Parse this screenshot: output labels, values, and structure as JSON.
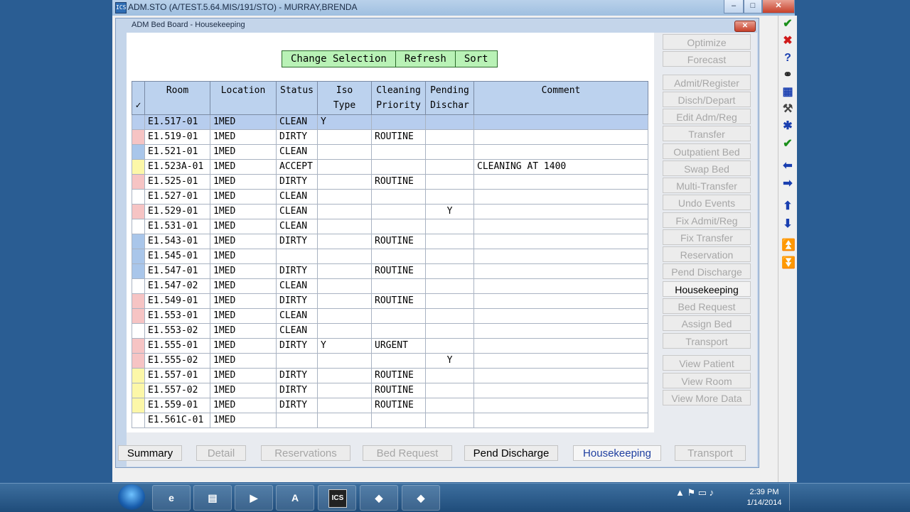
{
  "window": {
    "title": "ADM.STO (A/TEST.5.64.MIS/191/STO) - MURRAY,BRENDA",
    "app_icon": "ICS",
    "minimize": "–",
    "maximize": "□",
    "close": "✕"
  },
  "dialog": {
    "title": "ADM Bed Board - Housekeeping",
    "close": "✕"
  },
  "top_buttons": [
    "Change Selection",
    "Refresh",
    "Sort"
  ],
  "table": {
    "headers": {
      "check": "✓",
      "room": "Room",
      "location": "Location",
      "status": "Status",
      "iso1": "Iso",
      "iso2": "Type",
      "clean1": "Cleaning",
      "clean2": "Priority",
      "pend1": "Pending",
      "pend2": "Dischar",
      "comment": "Comment"
    },
    "rows": [
      {
        "color": "none",
        "room": "E1.517-01",
        "location": "1MED",
        "status": "CLEAN",
        "iso": "Y",
        "priority": "",
        "pending": "",
        "comment": ""
      },
      {
        "color": "pink",
        "room": "E1.519-01",
        "location": "1MED",
        "status": "DIRTY",
        "iso": "",
        "priority": "ROUTINE",
        "pending": "",
        "comment": ""
      },
      {
        "color": "blue",
        "room": "E1.521-01",
        "location": "1MED",
        "status": "CLEAN",
        "iso": "",
        "priority": "",
        "pending": "",
        "comment": ""
      },
      {
        "color": "yellow",
        "room": "E1.523A-01",
        "location": "1MED",
        "status": "ACCEPT",
        "iso": "",
        "priority": "",
        "pending": "",
        "comment": "CLEANING AT 1400"
      },
      {
        "color": "pink",
        "room": "E1.525-01",
        "location": "1MED",
        "status": "DIRTY",
        "iso": "",
        "priority": "ROUTINE",
        "pending": "",
        "comment": ""
      },
      {
        "color": "none",
        "room": "E1.527-01",
        "location": "1MED",
        "status": "CLEAN",
        "iso": "",
        "priority": "",
        "pending": "",
        "comment": ""
      },
      {
        "color": "pink",
        "room": "E1.529-01",
        "location": "1MED",
        "status": "CLEAN",
        "iso": "",
        "priority": "",
        "pending": "Y",
        "comment": ""
      },
      {
        "color": "none",
        "room": "E1.531-01",
        "location": "1MED",
        "status": "CLEAN",
        "iso": "",
        "priority": "",
        "pending": "",
        "comment": ""
      },
      {
        "color": "blue",
        "room": "E1.543-01",
        "location": "1MED",
        "status": "DIRTY",
        "iso": "",
        "priority": "ROUTINE",
        "pending": "",
        "comment": ""
      },
      {
        "color": "blue",
        "room": "E1.545-01",
        "location": "1MED",
        "status": "",
        "iso": "",
        "priority": "",
        "pending": "",
        "comment": ""
      },
      {
        "color": "blue",
        "room": "E1.547-01",
        "location": "1MED",
        "status": "DIRTY",
        "iso": "",
        "priority": "ROUTINE",
        "pending": "",
        "comment": ""
      },
      {
        "color": "none",
        "room": "E1.547-02",
        "location": "1MED",
        "status": "CLEAN",
        "iso": "",
        "priority": "",
        "pending": "",
        "comment": ""
      },
      {
        "color": "pink",
        "room": "E1.549-01",
        "location": "1MED",
        "status": "DIRTY",
        "iso": "",
        "priority": "ROUTINE",
        "pending": "",
        "comment": ""
      },
      {
        "color": "pink",
        "room": "E1.553-01",
        "location": "1MED",
        "status": "CLEAN",
        "iso": "",
        "priority": "",
        "pending": "",
        "comment": ""
      },
      {
        "color": "none",
        "room": "E1.553-02",
        "location": "1MED",
        "status": "CLEAN",
        "iso": "",
        "priority": "",
        "pending": "",
        "comment": ""
      },
      {
        "color": "pink",
        "room": "E1.555-01",
        "location": "1MED",
        "status": "DIRTY",
        "iso": "Y",
        "priority": "URGENT",
        "pending": "",
        "comment": ""
      },
      {
        "color": "pink",
        "room": "E1.555-02",
        "location": "1MED",
        "status": "",
        "iso": "",
        "priority": "",
        "pending": "Y",
        "comment": ""
      },
      {
        "color": "yellow",
        "room": "E1.557-01",
        "location": "1MED",
        "status": "DIRTY",
        "iso": "",
        "priority": "ROUTINE",
        "pending": "",
        "comment": ""
      },
      {
        "color": "yellow",
        "room": "E1.557-02",
        "location": "1MED",
        "status": "DIRTY",
        "iso": "",
        "priority": "ROUTINE",
        "pending": "",
        "comment": ""
      },
      {
        "color": "yellow",
        "room": "E1.559-01",
        "location": "1MED",
        "status": "DIRTY",
        "iso": "",
        "priority": "ROUTINE",
        "pending": "",
        "comment": ""
      },
      {
        "color": "none",
        "room": "E1.561C-01",
        "location": "1MED",
        "status": "",
        "iso": "",
        "priority": "",
        "pending": "",
        "comment": ""
      }
    ]
  },
  "side_buttons": [
    {
      "label": "Optimize",
      "active": false
    },
    {
      "label": "Forecast",
      "active": false
    },
    {
      "label": "Admit/Register",
      "active": false
    },
    {
      "label": "Disch/Depart",
      "active": false
    },
    {
      "label": "Edit Adm/Reg",
      "active": false
    },
    {
      "label": "Transfer",
      "active": false
    },
    {
      "label": "Outpatient Bed",
      "active": false
    },
    {
      "label": "Swap Bed",
      "active": false
    },
    {
      "label": "Multi-Transfer",
      "active": false
    },
    {
      "label": "Undo Events",
      "active": false
    },
    {
      "label": "Fix Admit/Reg",
      "active": false
    },
    {
      "label": "Fix Transfer",
      "active": false
    },
    {
      "label": "Reservation",
      "active": false
    },
    {
      "label": "Pend Discharge",
      "active": false
    },
    {
      "label": "Housekeeping",
      "active": true
    },
    {
      "label": "Bed Request",
      "active": false
    },
    {
      "label": "Assign Bed",
      "active": false
    },
    {
      "label": "Transport",
      "active": false
    },
    {
      "label": "View Patient",
      "active": false
    },
    {
      "label": "View Room",
      "active": false
    },
    {
      "label": "View More Data",
      "active": false
    }
  ],
  "bottom_tabs": [
    {
      "label": "Summary",
      "state": "on"
    },
    {
      "label": "Detail",
      "state": "off"
    },
    {
      "label": "Reservations",
      "state": "off"
    },
    {
      "label": "Bed Request",
      "state": "off"
    },
    {
      "label": "Pend Discharge",
      "state": "on"
    },
    {
      "label": "Housekeeping",
      "state": "cur"
    },
    {
      "label": "Transport",
      "state": "off"
    }
  ],
  "toolbar_icons": [
    {
      "name": "ok-check-icon",
      "glyph": "✔",
      "color": "#1a8f1a"
    },
    {
      "name": "cancel-x-icon",
      "glyph": "✖",
      "color": "#d01a1a"
    },
    {
      "name": "help-icon",
      "glyph": "?",
      "color": "#1a3fb0"
    },
    {
      "name": "binoculars-icon",
      "glyph": "⚭",
      "color": "#222222"
    },
    {
      "name": "calendar-icon",
      "glyph": "▦",
      "color": "#1a3fb0"
    },
    {
      "name": "tools-icon",
      "glyph": "⚒",
      "color": "#444444"
    },
    {
      "name": "asterisk-icon",
      "glyph": "✱",
      "color": "#1a3fb0"
    },
    {
      "name": "check-all-icon",
      "glyph": "✔",
      "color": "#1a8f1a"
    },
    {
      "name": "arrow-left-icon",
      "glyph": "⬅",
      "color": "#1a3fb0"
    },
    {
      "name": "arrow-right-icon",
      "glyph": "➡",
      "color": "#1a3fb0"
    },
    {
      "name": "arrow-up-icon",
      "glyph": "⬆",
      "color": "#1a3fb0"
    },
    {
      "name": "arrow-down-icon",
      "glyph": "⬇",
      "color": "#1a3fb0"
    },
    {
      "name": "page-up-icon",
      "glyph": "⏫",
      "color": "#1a8f1a"
    },
    {
      "name": "page-down-icon",
      "glyph": "⏬",
      "color": "#1a8f1a"
    }
  ],
  "taskbar": {
    "apps": [
      {
        "name": "ie-icon",
        "glyph": "e"
      },
      {
        "name": "folder-icon",
        "glyph": "▤"
      },
      {
        "name": "media-player-icon",
        "glyph": "▶"
      },
      {
        "name": "pdf-icon",
        "glyph": "A"
      },
      {
        "name": "ics-icon",
        "glyph": "ICS"
      },
      {
        "name": "app-icon",
        "glyph": "◆"
      },
      {
        "name": "app2-icon",
        "glyph": "◆"
      }
    ],
    "tray": "▲ ⚑ ▭ ♪",
    "time": "2:39 PM",
    "date": "1/14/2014"
  }
}
